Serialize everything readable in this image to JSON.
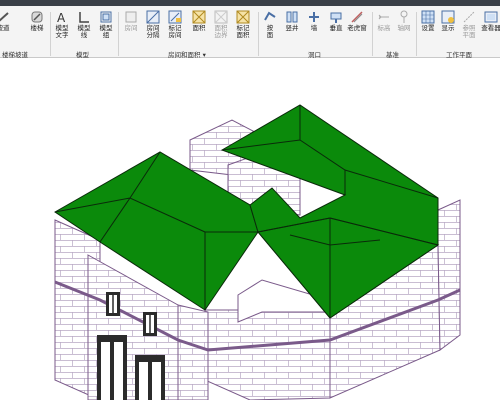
{
  "ribbon": {
    "tools": [
      {
        "id": "slope",
        "label": "坡道",
        "icon": "ramp-icon"
      },
      {
        "id": "stair",
        "label": "楼梯",
        "icon": "stair-icon"
      },
      {
        "id": "model-text",
        "label": "模型\n文字",
        "icon": "model-text-icon"
      },
      {
        "id": "model-line",
        "label": "模型\n线",
        "icon": "model-line-icon"
      },
      {
        "id": "model-group",
        "label": "模型\n组",
        "icon": "model-group-icon"
      },
      {
        "id": "room",
        "label": "房间",
        "icon": "room-icon",
        "disabled": true
      },
      {
        "id": "room-separator",
        "label": "房间\n分隔",
        "icon": "room-separator-icon"
      },
      {
        "id": "tag-room",
        "label": "标记\n房间",
        "icon": "tag-room-icon"
      },
      {
        "id": "area",
        "label": "面积",
        "icon": "area-icon"
      },
      {
        "id": "area-boundary",
        "label": "面积\n边界",
        "icon": "area-boundary-icon",
        "disabled": true
      },
      {
        "id": "tag-area",
        "label": "标记\n面积",
        "icon": "tag-area-icon"
      },
      {
        "id": "by-face",
        "label": "按\n面",
        "icon": "by-face-icon"
      },
      {
        "id": "shaft",
        "label": "竖井",
        "icon": "shaft-icon"
      },
      {
        "id": "wall",
        "label": "墙",
        "icon": "wall-opening-icon"
      },
      {
        "id": "vertical",
        "label": "垂直",
        "icon": "vertical-icon"
      },
      {
        "id": "dormer",
        "label": "老虎窗",
        "icon": "dormer-icon"
      },
      {
        "id": "level",
        "label": "标高",
        "icon": "level-icon",
        "disabled": true
      },
      {
        "id": "grid",
        "label": "轴网",
        "icon": "grid-icon",
        "disabled": true
      },
      {
        "id": "set",
        "label": "设置",
        "icon": "set-icon"
      },
      {
        "id": "show",
        "label": "显示",
        "icon": "show-icon"
      },
      {
        "id": "ref-plane",
        "label": "参照\n平面",
        "icon": "ref-plane-icon",
        "disabled": true
      },
      {
        "id": "viewer",
        "label": "查看器",
        "icon": "viewer-icon"
      }
    ],
    "groups": {
      "stair_ramp": "楼梯坡道",
      "model": "模型",
      "room_area": "房间和面积 ▾",
      "opening": "洞口",
      "datum": "基准",
      "work_plane": "工作平面"
    }
  },
  "colors": {
    "roof": "#0b8a0b",
    "roof_edge": "#0a2a0a",
    "brick_line": "#7a5a8a",
    "wall": "#ffffff"
  }
}
